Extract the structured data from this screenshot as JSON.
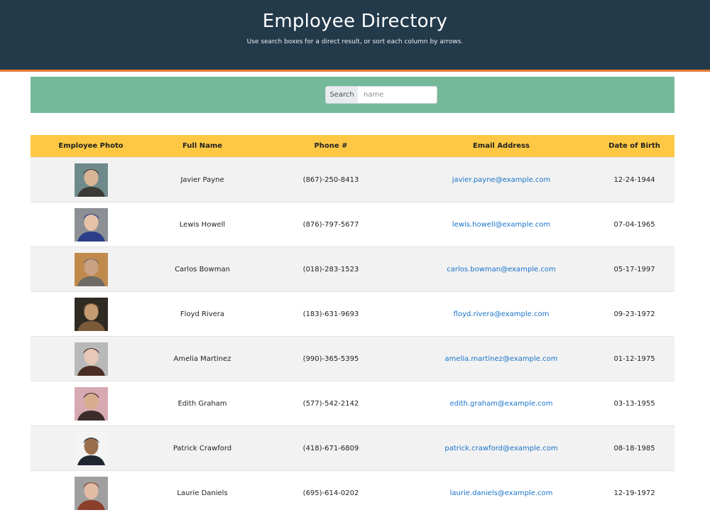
{
  "header": {
    "title": "Employee Directory",
    "subtitle": "Use search boxes for a direct result, or sort each column by arrows."
  },
  "search": {
    "label": "Search",
    "placeholder": "name",
    "value": ""
  },
  "colors": {
    "header_bg": "#233a4b",
    "header_accent": "#e67e35",
    "search_band": "#75b99a",
    "table_header": "#fec844",
    "link": "#1a73c9"
  },
  "table": {
    "columns": [
      "Employee Photo",
      "Full Name",
      "Phone #",
      "Email Address",
      "Date of Birth"
    ],
    "rows": [
      {
        "name": "Javier Payne",
        "phone": "(867)-250-8413",
        "email": "javier.payne@example.com",
        "dob": "12-24-1944"
      },
      {
        "name": "Lewis Howell",
        "phone": "(876)-797-5677",
        "email": "lewis.howell@example.com",
        "dob": "07-04-1965"
      },
      {
        "name": "Carlos Bowman",
        "phone": "(018)-283-1523",
        "email": "carlos.bowman@example.com",
        "dob": "05-17-1997"
      },
      {
        "name": "Floyd Rivera",
        "phone": "(183)-631-9693",
        "email": "floyd.rivera@example.com",
        "dob": "09-23-1972"
      },
      {
        "name": "Amelia Martinez",
        "phone": "(990)-365-5395",
        "email": "amelia.martinez@example.com",
        "dob": "01-12-1975"
      },
      {
        "name": "Edith Graham",
        "phone": "(577)-542-2142",
        "email": "edith.graham@example.com",
        "dob": "03-13-1955"
      },
      {
        "name": "Patrick Crawford",
        "phone": "(418)-671-6809",
        "email": "patrick.crawford@example.com",
        "dob": "08-18-1985"
      },
      {
        "name": "Laurie Daniels",
        "phone": "(695)-614-0202",
        "email": "laurie.daniels@example.com",
        "dob": "12-19-1972"
      }
    ]
  }
}
